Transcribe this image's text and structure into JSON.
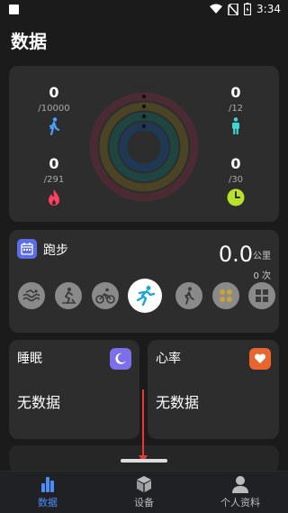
{
  "status_bar": {
    "time": "3:34"
  },
  "page_title": "数据",
  "activity": {
    "steps": {
      "value": "0",
      "goal": "/10000"
    },
    "calories": {
      "value": "0",
      "goal": "/291"
    },
    "stand": {
      "value": "0",
      "goal": "/12"
    },
    "exercise": {
      "value": "0",
      "goal": "/30"
    },
    "colors": {
      "steps": "#4aa0ff",
      "calories": "#ff3f5f",
      "stand": "#3fd7d0",
      "exercise": "#b9e02a"
    }
  },
  "sport": {
    "name": "跑步",
    "distance": "0.0",
    "unit": "公里",
    "count": "0 次",
    "icons": [
      "swim-icon",
      "elliptical-icon",
      "cycling-icon",
      "running-icon",
      "walking-icon",
      "climbing-icon",
      "more-sports-icon"
    ],
    "selected": "running-icon"
  },
  "sleep": {
    "title": "睡眠",
    "value": "无数据",
    "accent": "#7c6fe8"
  },
  "heart": {
    "title": "心率",
    "value": "无数据",
    "accent": "#e8652f"
  },
  "tabs": [
    {
      "label": "数据",
      "icon": "bar-chart-icon",
      "active": true
    },
    {
      "label": "设备",
      "icon": "cube-icon",
      "active": false
    },
    {
      "label": "个人资料",
      "icon": "person-icon",
      "active": false
    }
  ]
}
